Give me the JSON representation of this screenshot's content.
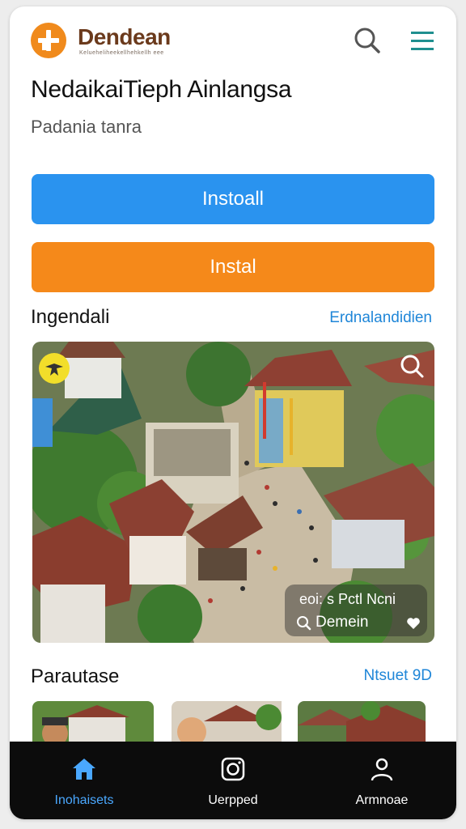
{
  "header": {
    "brand": "Dendean",
    "tagline": "Kelueheliheekellhehkellh eee",
    "search_icon": "search-icon",
    "menu_icon": "hamburger-menu-icon"
  },
  "hero": {
    "title": "NedaikaiTieph Ainlangsa",
    "subtitle": "Padania tanra"
  },
  "actions": {
    "primary_label": "Instoall",
    "secondary_label": "Instal"
  },
  "featured": {
    "title": "Ingendali",
    "link": "Erdnalandidien",
    "overlay_line1": "eoi: s Pctl Ncni",
    "overlay_line2": "Demein"
  },
  "more": {
    "title": "Parautase",
    "link": "Ntsuet  9D"
  },
  "tabbar": {
    "items": [
      {
        "label": "Inohaisets",
        "icon": "home-icon",
        "active": true
      },
      {
        "label": "Uerpped",
        "icon": "camera-icon",
        "active": false
      },
      {
        "label": "Armnoae",
        "icon": "profile-icon",
        "active": false
      }
    ]
  },
  "colors": {
    "primary_blue": "#2a93ef",
    "accent_orange": "#f5891a",
    "active_tab": "#4aa8ff",
    "link_blue": "#1f86d8"
  }
}
